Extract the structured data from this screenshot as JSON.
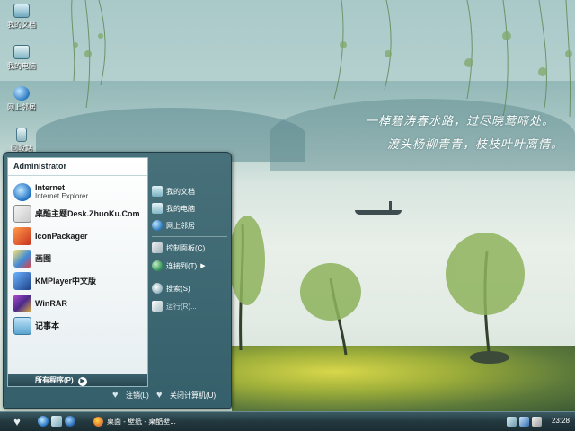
{
  "desktop": {
    "icons": [
      {
        "label": "我的文档",
        "icon": "folder-documents-icon"
      },
      {
        "label": "我的电脑",
        "icon": "computer-icon"
      },
      {
        "label": "网上邻居",
        "icon": "network-globe-icon"
      },
      {
        "label": "回收站",
        "icon": "recycle-bin-icon"
      }
    ],
    "poem_line_1": "一棹碧涛春水路，过尽晓莺啼处。",
    "poem_line_2": "渡头杨柳青青，枝枝叶叶离情。"
  },
  "start_menu": {
    "user_name": "Administrator",
    "pinned": [
      {
        "name": "Internet",
        "sub": "Internet Explorer",
        "icon": "internet-explorer-icon"
      },
      {
        "name": "桌酷主题Desk.ZhuoKu.Com",
        "sub": "",
        "icon": "zhuoku-theme-icon"
      }
    ],
    "recent": [
      {
        "name": "IconPackager",
        "icon": "iconpackager-icon"
      },
      {
        "name": "画图",
        "icon": "paint-icon"
      },
      {
        "name": "KMPlayer中文版",
        "icon": "kmplayer-icon"
      },
      {
        "name": "WinRAR",
        "icon": "winrar-icon"
      },
      {
        "name": "记事本",
        "icon": "notepad-icon"
      }
    ],
    "all_programs_label": "所有程序(P)",
    "all_programs_arrow": "▶",
    "places": [
      {
        "label": "我的文档",
        "icon": "my-documents-icon"
      },
      {
        "label": "我的电脑",
        "icon": "my-computer-icon"
      },
      {
        "label": "网上邻居",
        "icon": "my-network-icon"
      }
    ],
    "system": [
      {
        "label": "控制面板(C)",
        "icon": "control-panel-icon"
      },
      {
        "label": "连接到(T)",
        "icon": "connect-to-icon",
        "submenu_arrow": "▶"
      },
      {
        "label": "搜索(S)",
        "icon": "search-icon"
      },
      {
        "label": "运行(R)...",
        "icon": "run-icon"
      }
    ],
    "logoff_label": "注销(L)",
    "shutdown_label": "关闭计算机(U)"
  },
  "taskbar": {
    "start_glyph": "♥",
    "quick_launch": [
      "internet-explorer-icon",
      "show-desktop-icon",
      "media-player-icon"
    ],
    "task_label": "桌面 - 壁纸 - 桌酷壁...",
    "tray_icons": [
      "network-tray-icon",
      "volume-tray-icon",
      "security-tray-icon"
    ],
    "clock": "23:28"
  },
  "colors": {
    "menu_frame": "#3d6670",
    "taskbar": "#23393f",
    "left_pane": "#ffffff"
  }
}
